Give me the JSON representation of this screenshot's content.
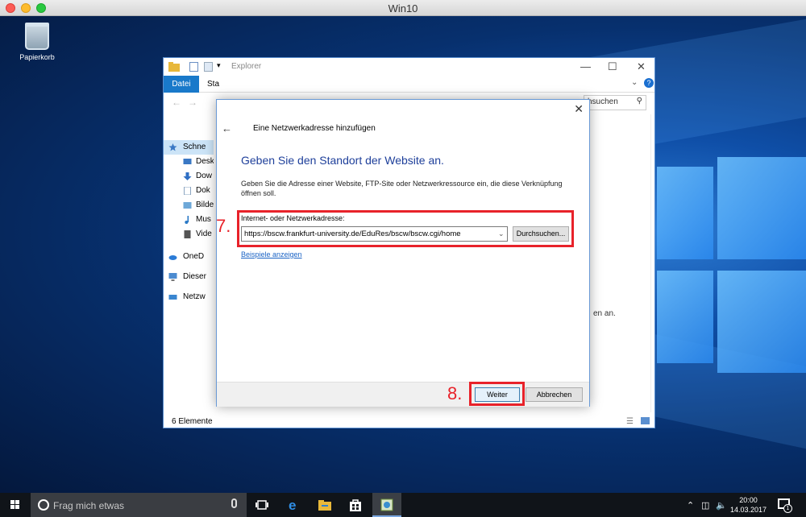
{
  "mac_window": {
    "title": "Win10"
  },
  "desktop": {
    "recycle_bin_label": "Papierkorb"
  },
  "explorer": {
    "title": "Explorer",
    "ribbon": {
      "file_tab": "Datei",
      "tab_partial": "Sta"
    },
    "search_placeholder": "hsuchen",
    "nav_items": [
      {
        "label": "Schne",
        "icon": "star-icon",
        "color": "#3a78c4"
      },
      {
        "label": "Desk",
        "icon": "desktop-icon",
        "color": "#3a78c4"
      },
      {
        "label": "Dow",
        "icon": "download-icon",
        "color": "#2f6fc4"
      },
      {
        "label": "Dok",
        "icon": "document-icon",
        "color": "#8aa4c0"
      },
      {
        "label": "Bilde",
        "icon": "pictures-icon",
        "color": "#6ea8d8"
      },
      {
        "label": "Mus",
        "icon": "music-icon",
        "color": "#2a79c6"
      },
      {
        "label": "Vide",
        "icon": "video-icon",
        "color": "#555555"
      },
      {
        "label": "OneD",
        "icon": "onedrive-icon",
        "color": "#2a7bd6"
      },
      {
        "label": "Dieser",
        "icon": "computer-icon",
        "color": "#4c8bd0"
      },
      {
        "label": "Netzw",
        "icon": "network-icon",
        "color": "#3a86d0"
      }
    ],
    "right_text_partial": "en an.",
    "status_items": "6 Elemente"
  },
  "dialog": {
    "header": "Eine Netzwerkadresse hinzufügen",
    "title": "Geben Sie den Standort der Website an.",
    "description": "Geben Sie die Adresse einer Website, FTP-Site oder Netzwerkressource ein, die diese Verknüpfung öffnen soll.",
    "field_label": "Internet- oder Netzwerkadresse:",
    "url_value": "https://bscw.frankfurt-university.de/EduRes/bscw/bscw.cgi/home",
    "browse_button": "Durchsuchen...",
    "examples_link": "Beispiele anzeigen",
    "next_button": "Weiter",
    "cancel_button": "Abbrechen"
  },
  "annotations": {
    "step7": "7.",
    "step8": "8.",
    "highlight_color": "#e8222a"
  },
  "taskbar": {
    "search_placeholder": "Frag mich etwas",
    "time": "20:00",
    "date": "14.03.2017",
    "notification_count": "1"
  }
}
